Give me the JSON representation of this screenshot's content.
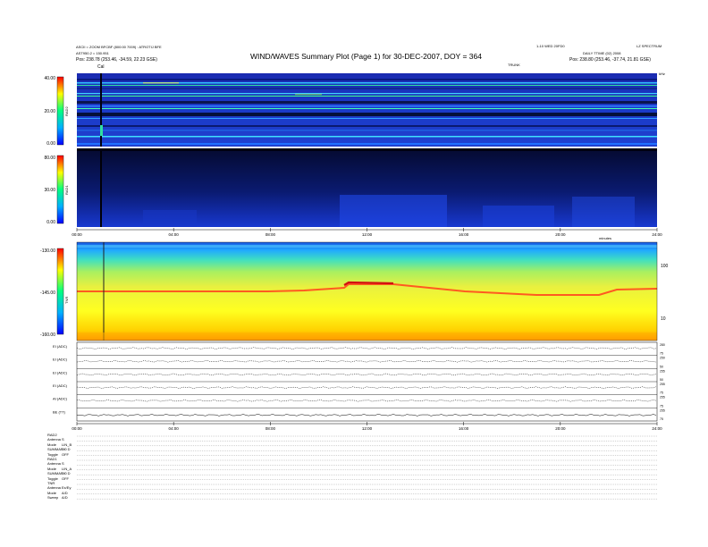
{
  "header": {
    "title": "WIND/WAVES Summary Plot (Page 1) for 30-DEC-2007, DOY = 364",
    "left_line1": "ASCII = ZOOM BFCBF (800:00 7009) : ATROTIJ BFE",
    "left_line2": "AST950.2 = 150.951",
    "left_pos": "Pos: 238.78 (253.46, -34.59, 22.23 GSE)",
    "right_line0": "LZ SPECTRUM",
    "right_line1": "DAILY TTIME (02) 2008",
    "right_pos": "Pos: 238.80 (253.46, -37.74, 21.81 GSE)",
    "center_small": "1-10 WED 20FD0",
    "mid_label": "TRUNK",
    "cal_label": "Cal",
    "right_corner": "kHz"
  },
  "chart_data": [
    {
      "type": "heatmap",
      "name_label": "RAD2",
      "yticks": [
        "40.00",
        "20.00",
        "0.00"
      ],
      "ylim": [
        0,
        40
      ]
    },
    {
      "type": "heatmap",
      "name_label": "RAD1",
      "yticks": [
        "80.00",
        "30.00",
        "0.00"
      ],
      "ylim": [
        0,
        80
      ]
    },
    {
      "type": "heatmap",
      "name_label": "TNR",
      "yticks": [
        "-130.00",
        "-145.00",
        "-160.00"
      ],
      "ylim": [
        -160,
        -130
      ],
      "right_ticks": [
        "100",
        "10"
      ],
      "xticks": [
        "00:00",
        "04:00",
        "08:00",
        "12:00",
        "16:00",
        "20:00",
        "24:00"
      ],
      "xunit": "minutes"
    },
    {
      "type": "line",
      "channels": [
        {
          "label": "EI (ADC)",
          "right_ticks": [
            "280",
            "75"
          ]
        },
        {
          "label": "EI (ADC)",
          "right_ticks": [
            "250",
            "50"
          ]
        },
        {
          "label": "EI (ADC)",
          "right_ticks": [
            "255",
            "50"
          ]
        },
        {
          "label": "EI (ADC)",
          "right_ticks": [
            "255",
            "75"
          ]
        },
        {
          "label": "AI (ADC)",
          "right_ticks": [
            "255",
            "75"
          ]
        },
        {
          "label": "BE (TT)",
          "right_ticks": [
            "255",
            "75"
          ]
        }
      ],
      "xticks": [
        "00:00",
        "04:00",
        "08:00",
        "12:00",
        "16:00",
        "20:00",
        "24:00"
      ]
    }
  ],
  "info": [
    {
      "k": "RAD2",
      "v": ""
    },
    {
      "k": "Antenna",
      "v": "S"
    },
    {
      "k": "Mode",
      "v": "LIN_B"
    },
    {
      "k": "SUMMARY",
      "v": "1.0 D"
    },
    {
      "k": "Toggle",
      "v": "OFF"
    },
    {
      "k": "RAD1",
      "v": ""
    },
    {
      "k": "Antenna",
      "v": "S"
    },
    {
      "k": "Mode",
      "v": "LIN_A"
    },
    {
      "k": "SUMMARY",
      "v": "1.0 D"
    },
    {
      "k": "Toggle",
      "v": "OFF"
    },
    {
      "k": "TNR",
      "v": ""
    },
    {
      "k": "Antenna",
      "v": "Ex/Ey"
    },
    {
      "k": "Mode",
      "v": "A/D"
    },
    {
      "k": "Sweep",
      "v": "A/D"
    }
  ]
}
